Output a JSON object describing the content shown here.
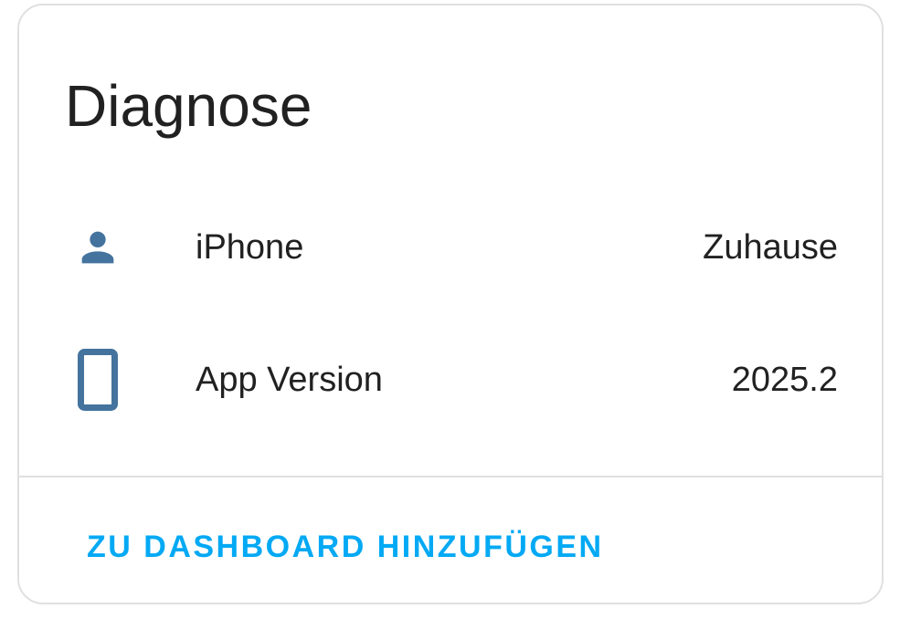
{
  "card": {
    "title": "Diagnose",
    "rows": [
      {
        "icon": "person-icon",
        "label": "iPhone",
        "value": "Zuhause"
      },
      {
        "icon": "cellphone-icon",
        "label": "App Version",
        "value": "2025.2"
      }
    ],
    "action_label": "ZU DASHBOARD HINZUFÜGEN"
  },
  "colors": {
    "icon": "#44739e",
    "accent": "#03a9f4",
    "text": "#212121",
    "border": "#e0e0e0"
  }
}
